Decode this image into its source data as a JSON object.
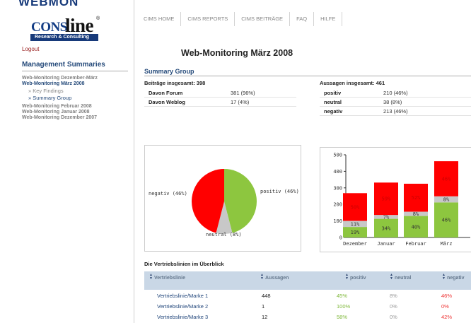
{
  "brand": {
    "top_text": "WEBMON",
    "logo_part1": "CONS",
    "logo_part2": "line",
    "logo_registered": "®",
    "logo_tagline": "Research & Consulting"
  },
  "logout_label": "Logout",
  "sidebar": {
    "title": "Management Summaries",
    "items": [
      {
        "label": "Web-Monitoring Dezember-März",
        "active": false,
        "sub": false
      },
      {
        "label": "Web-Monitoring März 2008",
        "active": true,
        "sub": false
      },
      {
        "label": "» Key Findings",
        "active": false,
        "sub": true
      },
      {
        "label": "» Summary Group",
        "active": true,
        "sub": true
      },
      {
        "label": "Web-Monitoring Februar 2008",
        "active": false,
        "sub": false
      },
      {
        "label": "Web-Monitoring Januar 2008",
        "active": false,
        "sub": false
      },
      {
        "label": "Web-Monitoring Dezember 2007",
        "active": false,
        "sub": false
      }
    ]
  },
  "nav": {
    "tabs": [
      "CIMS HOME",
      "CIMS REPORTS",
      "CIMS BEITRÄGE",
      "FAQ",
      "HILFE"
    ]
  },
  "page_title": "Web-Monitoring März 2008",
  "summary": {
    "section_title": "Summary Group",
    "beitraege": {
      "heading": "Beiträge insgesamt: 398",
      "rows": [
        {
          "label": "Davon Forum",
          "value": "381 (96%)"
        },
        {
          "label": "Davon Weblog",
          "value": "17 (4%)"
        }
      ]
    },
    "aussagen": {
      "heading": "Aussagen insgesamt: 461",
      "rows": [
        {
          "label": "positiv",
          "value": "210 (46%)"
        },
        {
          "label": "neutral",
          "value": "38 (8%)"
        },
        {
          "label": "negativ",
          "value": "213 (46%)"
        }
      ]
    }
  },
  "colors": {
    "positiv": "#8dc63f",
    "neutral": "#c8c8c8",
    "negativ": "#ff0000",
    "accent": "#254a7a"
  },
  "chart_data": [
    {
      "type": "pie",
      "slices": [
        {
          "name": "positiv",
          "value": 46,
          "label": "positiv (46%)"
        },
        {
          "name": "neutral",
          "value": 8,
          "label": "neutral (8%)"
        },
        {
          "name": "negativ",
          "value": 46,
          "label": "negativ (46%)"
        }
      ]
    },
    {
      "type": "bar",
      "stacked": true,
      "categories": [
        "Dezember",
        "Januar",
        "Februar",
        "März"
      ],
      "ylim": [
        0,
        500
      ],
      "yticks": [
        0,
        100,
        200,
        300,
        400,
        500
      ],
      "totals": [
        335,
        332,
        325,
        461
      ],
      "series": [
        {
          "name": "positiv",
          "values": [
            19,
            34,
            40,
            46
          ],
          "labels": [
            "19%",
            "34%",
            "40%",
            "46%"
          ]
        },
        {
          "name": "neutral",
          "values": [
            11,
            7,
            8,
            8
          ],
          "labels": [
            "11%",
            "7%",
            "8%",
            "8%"
          ]
        },
        {
          "name": "negativ",
          "values": [
            50,
            59,
            52,
            46
          ],
          "labels": [
            "50%",
            "59%",
            "52%",
            "46%"
          ]
        }
      ]
    }
  ],
  "vertriebslinien": {
    "title": "Die Vertriebslinien im Überblick",
    "columns": [
      "Vertriebslinie",
      "Aussagen",
      "positiv",
      "neutral",
      "negativ"
    ],
    "rows": [
      {
        "name": "Vertriebslinie/Marke 1",
        "aussagen": "448",
        "positiv": "45%",
        "neutral": "8%",
        "negativ": "46%"
      },
      {
        "name": "Vertriebslinie/Marke 2",
        "aussagen": "1",
        "positiv": "100%",
        "neutral": "0%",
        "negativ": "0%"
      },
      {
        "name": "Vertriebslinie/Marke 3",
        "aussagen": "12",
        "positiv": "58%",
        "neutral": "0%",
        "negativ": "42%"
      }
    ]
  }
}
